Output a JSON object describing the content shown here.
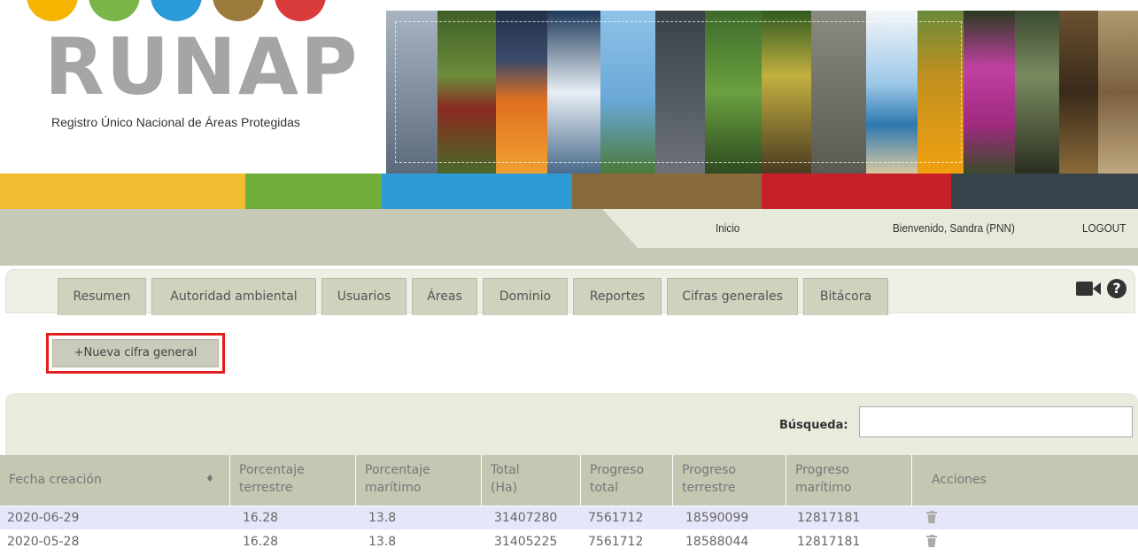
{
  "logo": {
    "title": "RUNAP",
    "subtitle": "Registro Único Nacional de Áreas Protegidas",
    "circle_colors": [
      "#f4b400",
      "#7ab547",
      "#2a9ad8",
      "#9c7a3c",
      "#d93a3a"
    ]
  },
  "banner": {
    "strip_colors": [
      "#7d8a9a",
      "#5d7b3a",
      "#2c3b5a",
      "#e07020",
      "#3f6c8c",
      "#6aa0c8",
      "#3a4048",
      "#4f7c40",
      "#6b6a60",
      "#ffffff",
      "#4a8cc0",
      "#e89a10",
      "#c040a0",
      "#5a4a30",
      "#8a6a3a",
      "#a08a60"
    ]
  },
  "colorbars": [
    "#f3bb2f",
    "#6fae3a",
    "#2f9bd6",
    "#8a6a3b",
    "#c8202a",
    "#39434c"
  ],
  "topnav": {
    "inicio": "Inicio",
    "welcome": "Bienvenido, Sandra (PNN)",
    "logout": "LOGOUT"
  },
  "tabs": [
    "Resumen",
    "Autoridad ambiental",
    "Usuarios",
    "Áreas",
    "Dominio",
    "Reportes",
    "Cifras generales",
    "Bitácora"
  ],
  "icons": {
    "video": "video-camera-icon",
    "help": "question-circle-icon",
    "sort": "sort-icon",
    "delete": "trash-icon"
  },
  "new_button": "+Nueva cifra general",
  "search": {
    "label": "Búsqueda:",
    "value": ""
  },
  "table": {
    "headers": [
      [
        "Fecha creación"
      ],
      [
        "Porcentaje",
        "terrestre"
      ],
      [
        "Porcentaje",
        "marítimo"
      ],
      [
        "Total",
        "(Ha)"
      ],
      [
        "Progreso",
        "total"
      ],
      [
        "Progreso",
        "terrestre"
      ],
      [
        "Progreso",
        "marítimo"
      ],
      [
        "Acciones"
      ]
    ],
    "rows": [
      [
        "2020-06-29",
        "16.28",
        "13.8",
        "31407280",
        "7561712",
        "18590099",
        "12817181"
      ],
      [
        "2020-05-28",
        "16.28",
        "13.8",
        "31405225",
        "7561712",
        "18588044",
        "12817181"
      ]
    ]
  }
}
